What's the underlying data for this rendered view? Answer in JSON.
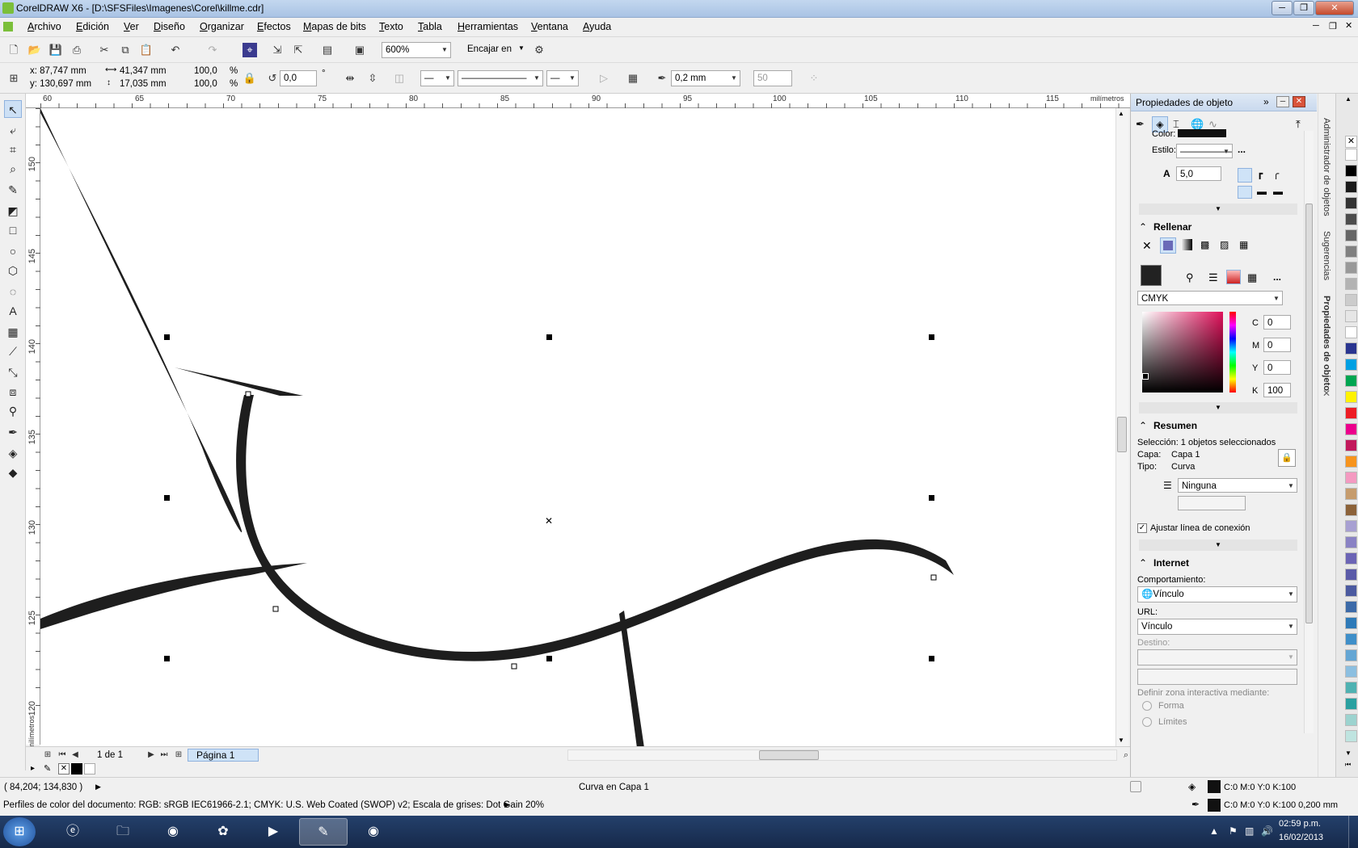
{
  "window": {
    "title": "CorelDRAW X6 - [D:\\SFSFiles\\Imagenes\\Corel\\killme.cdr]"
  },
  "menu": [
    "Archivo",
    "Edición",
    "Ver",
    "Diseño",
    "Organizar",
    "Efectos",
    "Mapas de bits",
    "Texto",
    "Tabla",
    "Herramientas",
    "Ventana",
    "Ayuda"
  ],
  "toolbar": {
    "zoom": "600%",
    "snap": "Encajar en"
  },
  "propbar": {
    "x": "x: 87,747 mm",
    "y": "y: 130,697 mm",
    "w": "41,347 mm",
    "h": "17,035 mm",
    "sx": "100,0",
    "sy": "100,0",
    "pct1": "%",
    "pct2": "%",
    "angle": "0,0",
    "deg": "°",
    "outline_width": "0,2 mm",
    "curve_smooth": "50"
  },
  "ruler": {
    "h_ticks": [
      "60",
      "65",
      "70",
      "75",
      "80",
      "85",
      "90",
      "95",
      "100",
      "105",
      "110",
      "115"
    ],
    "h_unit": "milímetros",
    "v_ticks": [
      "150",
      "145",
      "140",
      "135",
      "130",
      "125",
      "120"
    ],
    "v_unit": "milímetros"
  },
  "pager": {
    "count": "1 de 1",
    "tab": "Página 1"
  },
  "status": {
    "coords": "( 84,204; 134,830 )",
    "object": "Curva en Capa 1",
    "profiles": "Perfiles de color del documento: RGB: sRGB IEC61966-2.1; CMYK: U.S. Web Coated (SWOP) v2; Escala de grises: Dot Gain 20%",
    "fill": "C:0 M:0 Y:0 K:100",
    "outline": "C:0 M:0 Y:0 K:100  0,200 mm"
  },
  "docker": {
    "title": "Propiedades de objeto",
    "color_label": "Color:",
    "style_label": "Estilo:",
    "miter": "5,0",
    "fill_section": "Rellenar",
    "color_model": "CMYK",
    "cmyk": {
      "c_label": "C",
      "c": "0",
      "m_label": "M",
      "m": "0",
      "y_label": "Y",
      "y": "0",
      "k_label": "K",
      "k": "100"
    },
    "summary_section": "Resumen",
    "selection": "Selección: 1 objetos seleccionados",
    "layer_label": "Capa:",
    "layer": "Capa 1",
    "type_label": "Tipo:",
    "type": "Curva",
    "wrap": "Ninguna",
    "adjust_connector": "Ajustar línea de conexión",
    "internet_section": "Internet",
    "behavior_label": "Comportamiento:",
    "behavior": "Vínculo",
    "url_label": "URL:",
    "url": "Vínculo",
    "target_label": "Destino:",
    "define_zone": "Definir zona interactiva mediante:",
    "shape_opt": "Forma",
    "limits_opt": "Límites",
    "ellipsis": "..."
  },
  "sidetabs": [
    "Administrador de objetos",
    "Sugerencias",
    "Propiedades de objeto"
  ],
  "palette": [
    "#ffffff",
    "#000000",
    "#1a1a1a",
    "#333333",
    "#4d4d4d",
    "#666666",
    "#808080",
    "#999999",
    "#b3b3b3",
    "#cccccc",
    "#e6e6e6",
    "#ffffff",
    "#2a3590",
    "#00a0e3",
    "#00a651",
    "#fff200",
    "#ed1c24",
    "#ec008c",
    "#c2185b",
    "#f7941d",
    "#f49ac1",
    "#c69c6d",
    "#8c6239",
    "#a8a0d2",
    "#8a82c4",
    "#6b64b5",
    "#5a5aa8",
    "#4b5aa0",
    "#3c6aa8",
    "#2e7ab8",
    "#3f8fc9",
    "#64a6d4",
    "#8cbfe0",
    "#4fb2b2",
    "#2aa0a0",
    "#9cd3cf",
    "#bfe4e0"
  ],
  "clock": {
    "time": "02:59 p.m.",
    "date": "16/02/2013"
  },
  "colors": {
    "accent": "#4a7bbd",
    "page_tab": "#cfe3f7"
  }
}
